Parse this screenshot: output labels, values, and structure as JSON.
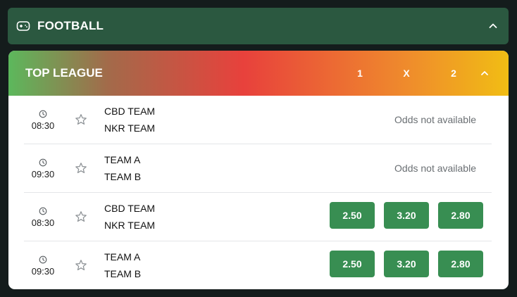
{
  "sport": {
    "title": "FOOTBALL",
    "icon": "gamepad-icon"
  },
  "league": {
    "title": "TOP LEAGUE",
    "columns": [
      "1",
      "X",
      "2"
    ]
  },
  "matches": [
    {
      "time": "08:30",
      "home": "CBD TEAM",
      "away": "NKR TEAM",
      "odds_status": "Odds not available"
    },
    {
      "time": "09:30",
      "home": "TEAM A",
      "away": "TEAM B",
      "odds_status": "Odds not available"
    },
    {
      "time": "08:30",
      "home": "CBD TEAM",
      "away": "NKR TEAM",
      "odds": [
        "2.50",
        "3.20",
        "2.80"
      ]
    },
    {
      "time": "09:30",
      "home": "TEAM A",
      "away": "TEAM B",
      "odds": [
        "2.50",
        "3.20",
        "2.80"
      ]
    }
  ],
  "colors": {
    "sport_header_bg": "#2b5840",
    "odds_button_bg": "#388e52",
    "page_bg": "#141c1c"
  }
}
